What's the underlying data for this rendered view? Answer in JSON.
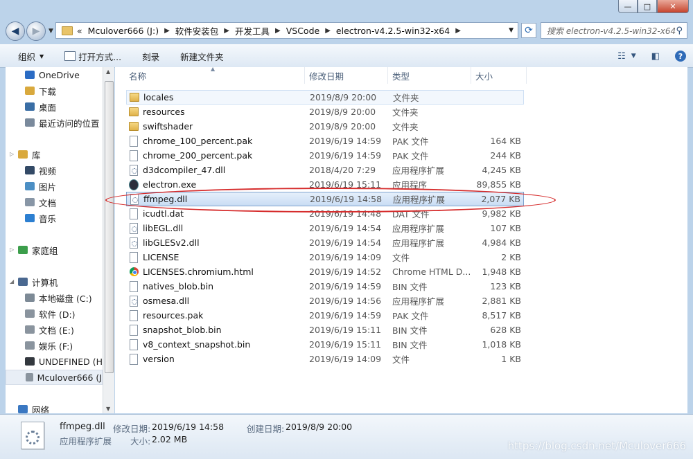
{
  "window": {
    "minimize_glyph": "—",
    "maximize_glyph": "□",
    "close_glyph": "✕"
  },
  "nav": {
    "back_glyph": "◀",
    "forward_glyph": "▶",
    "breadcrumbs": [
      "Mculover666 (J:)",
      "软件安装包",
      "开发工具",
      "VSCode",
      "electron-v4.2.5-win32-x64"
    ],
    "overflow": "«",
    "search_placeholder": "搜索 electron-v4.2.5-win32-x64"
  },
  "toolbar": {
    "organize": "组织",
    "open_with": "打开方式...",
    "burn": "刻录",
    "new_folder": "新建文件夹"
  },
  "sidebar": {
    "items": [
      {
        "label": "OneDrive",
        "icon": "cloud-icon",
        "color": "#2b6cc4"
      },
      {
        "label": "下载",
        "icon": "download-folder-icon",
        "color": "#d9a93d"
      },
      {
        "label": "桌面",
        "icon": "desktop-icon",
        "color": "#3a6ea5"
      },
      {
        "label": "最近访问的位置",
        "icon": "recent-places-icon",
        "color": "#7a8a9c"
      },
      {
        "label": "库",
        "icon": "library-icon",
        "color": "#d9a93d"
      },
      {
        "label": "视频",
        "icon": "video-icon",
        "color": "#334a66"
      },
      {
        "label": "图片",
        "icon": "pictures-icon",
        "color": "#4c8fc4"
      },
      {
        "label": "文档",
        "icon": "documents-icon",
        "color": "#8896a6"
      },
      {
        "label": "音乐",
        "icon": "music-icon",
        "color": "#2c7fd1"
      },
      {
        "label": "家庭组",
        "icon": "homegroup-icon",
        "color": "#3c9e4b"
      },
      {
        "label": "计算机",
        "icon": "computer-icon",
        "color": "#4a6890"
      },
      {
        "label": "本地磁盘 (C:)",
        "icon": "system-drive-icon",
        "color": "#7d8a96"
      },
      {
        "label": "软件 (D:)",
        "icon": "drive-icon",
        "color": "#8a949e"
      },
      {
        "label": "文档 (E:)",
        "icon": "drive-icon",
        "color": "#8a949e"
      },
      {
        "label": "娱乐 (F:)",
        "icon": "drive-icon",
        "color": "#8a949e"
      },
      {
        "label": "UNDEFINED (H",
        "icon": "removable-drive-icon",
        "color": "#33383e"
      },
      {
        "label": "Mculover666 (J",
        "icon": "drive-icon",
        "color": "#8a949e"
      },
      {
        "label": "网络",
        "icon": "network-icon",
        "color": "#3a78c2"
      }
    ]
  },
  "columns": {
    "name": "名称",
    "date": "修改日期",
    "type": "类型",
    "size": "大小"
  },
  "files": [
    {
      "name": "locales",
      "date": "2019/8/9 20:00",
      "type": "文件夹",
      "size": "",
      "icon": "folder-icon"
    },
    {
      "name": "resources",
      "date": "2019/8/9 20:00",
      "type": "文件夹",
      "size": "",
      "icon": "folder-icon"
    },
    {
      "name": "swiftshader",
      "date": "2019/8/9 20:00",
      "type": "文件夹",
      "size": "",
      "icon": "folder-icon"
    },
    {
      "name": "chrome_100_percent.pak",
      "date": "2019/6/19 14:59",
      "type": "PAK 文件",
      "size": "164 KB",
      "icon": "file-icon"
    },
    {
      "name": "chrome_200_percent.pak",
      "date": "2019/6/19 14:59",
      "type": "PAK 文件",
      "size": "244 KB",
      "icon": "file-icon"
    },
    {
      "name": "d3dcompiler_47.dll",
      "date": "2018/4/20 7:29",
      "type": "应用程序扩展",
      "size": "4,245 KB",
      "icon": "dll-icon"
    },
    {
      "name": "electron.exe",
      "date": "2019/6/19 15:11",
      "type": "应用程序",
      "size": "89,855 KB",
      "icon": "electron-icon"
    },
    {
      "name": "ffmpeg.dll",
      "date": "2019/6/19 14:58",
      "type": "应用程序扩展",
      "size": "2,077 KB",
      "icon": "dll-icon"
    },
    {
      "name": "icudtl.dat",
      "date": "2019/6/19 14:48",
      "type": "DAT 文件",
      "size": "9,982 KB",
      "icon": "file-icon"
    },
    {
      "name": "libEGL.dll",
      "date": "2019/6/19 14:54",
      "type": "应用程序扩展",
      "size": "107 KB",
      "icon": "dll-icon"
    },
    {
      "name": "libGLESv2.dll",
      "date": "2019/6/19 14:54",
      "type": "应用程序扩展",
      "size": "4,984 KB",
      "icon": "dll-icon"
    },
    {
      "name": "LICENSE",
      "date": "2019/6/19 14:09",
      "type": "文件",
      "size": "2 KB",
      "icon": "file-icon"
    },
    {
      "name": "LICENSES.chromium.html",
      "date": "2019/6/19 14:52",
      "type": "Chrome HTML D...",
      "size": "1,948 KB",
      "icon": "chrome-icon"
    },
    {
      "name": "natives_blob.bin",
      "date": "2019/6/19 14:59",
      "type": "BIN 文件",
      "size": "123 KB",
      "icon": "file-icon"
    },
    {
      "name": "osmesa.dll",
      "date": "2019/6/19 14:56",
      "type": "应用程序扩展",
      "size": "2,881 KB",
      "icon": "dll-icon"
    },
    {
      "name": "resources.pak",
      "date": "2019/6/19 14:59",
      "type": "PAK 文件",
      "size": "8,517 KB",
      "icon": "file-icon"
    },
    {
      "name": "snapshot_blob.bin",
      "date": "2019/6/19 15:11",
      "type": "BIN 文件",
      "size": "628 KB",
      "icon": "file-icon"
    },
    {
      "name": "v8_context_snapshot.bin",
      "date": "2019/6/19 15:11",
      "type": "BIN 文件",
      "size": "1,018 KB",
      "icon": "file-icon"
    },
    {
      "name": "version",
      "date": "2019/6/19 14:09",
      "type": "文件",
      "size": "1 KB",
      "icon": "file-icon"
    }
  ],
  "details": {
    "name": "ffmpeg.dll",
    "type": "应用程序扩展",
    "modified_label": "修改日期:",
    "modified": "2019/6/19 14:58",
    "size_label": "大小:",
    "size": "2.02 MB",
    "created_label": "创建日期:",
    "created": "2019/8/9 20:00"
  },
  "watermark": "https://blog.csdn.net/Mculover666"
}
